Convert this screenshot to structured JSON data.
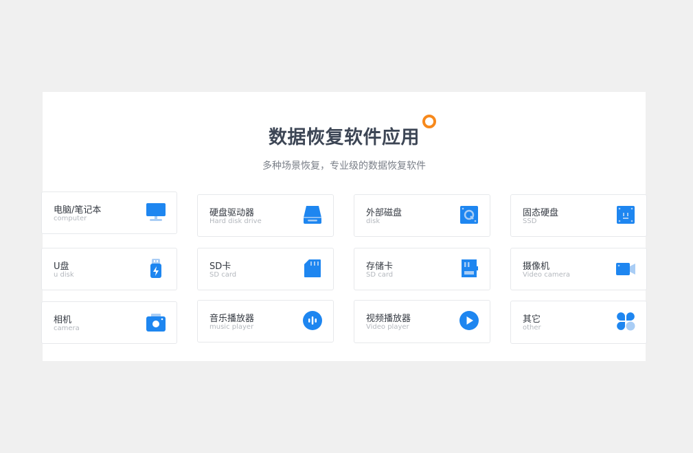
{
  "header": {
    "title": "数据恢复软件应用",
    "subtitle": "多种场景恢复，专业级的数据恢复软件"
  },
  "colors": {
    "primary": "#1e86f0",
    "light": "#a9cdf5",
    "accent_ring": "#f7891c"
  },
  "cards": [
    {
      "name": "电脑/笔记本",
      "sub": "computer",
      "icon": "monitor-icon"
    },
    {
      "name": "硬盘驱动器",
      "sub": "Hard disk drive",
      "icon": "hard-drive-icon"
    },
    {
      "name": "外部磁盘",
      "sub": "disk",
      "icon": "external-disk-icon"
    },
    {
      "name": "固态硬盘",
      "sub": "SSD",
      "icon": "ssd-icon"
    },
    {
      "name": "U盘",
      "sub": "u disk",
      "icon": "usb-drive-icon"
    },
    {
      "name": "SD卡",
      "sub": "SD card",
      "icon": "sd-card-icon"
    },
    {
      "name": "存储卡",
      "sub": "SD card",
      "icon": "memory-card-icon"
    },
    {
      "name": "摄像机",
      "sub": "Video camera",
      "icon": "video-camera-icon"
    },
    {
      "name": "相机",
      "sub": "camera",
      "icon": "camera-icon"
    },
    {
      "name": "音乐播放器",
      "sub": "music player",
      "icon": "music-player-icon"
    },
    {
      "name": "视频播放器",
      "sub": "Video player",
      "icon": "video-player-icon"
    },
    {
      "name": "其它",
      "sub": "other",
      "icon": "other-icon"
    }
  ]
}
